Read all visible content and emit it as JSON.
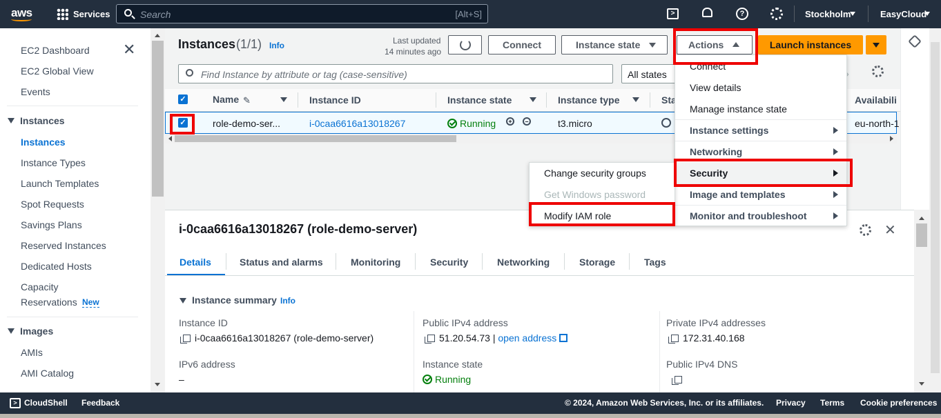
{
  "topnav": {
    "logo": "aws",
    "services": "Services",
    "search_placeholder": "Search",
    "search_shortcut": "[Alt+S]",
    "region": "Stockholm",
    "account": "EasyCloud"
  },
  "sidebar": {
    "items_top": [
      "EC2 Dashboard",
      "EC2 Global View",
      "Events"
    ],
    "instances_header": "Instances",
    "instances_items": [
      "Instances",
      "Instance Types",
      "Launch Templates",
      "Spot Requests",
      "Savings Plans",
      "Reserved Instances",
      "Dedicated Hosts",
      "Capacity",
      "Reservations"
    ],
    "new_badge": "New",
    "images_header": "Images",
    "images_items": [
      "AMIs",
      "AMI Catalog"
    ]
  },
  "main": {
    "title": "Instances",
    "count": "(1/1)",
    "info": "Info",
    "last_updated_label": "Last updated",
    "last_updated_value": "14 minutes ago",
    "connect": "Connect",
    "instance_state": "Instance state",
    "actions": "Actions",
    "launch": "Launch instances",
    "filter_placeholder": "Find Instance by attribute or tag (case-sensitive)",
    "states_filter": "All states",
    "columns": [
      "Name",
      "Instance ID",
      "Instance state",
      "Instance type",
      "Sta",
      "Availabili"
    ],
    "row": {
      "name": "role-demo-ser...",
      "id": "i-0caa6616a13018267",
      "state": "Running",
      "type": "t3.micro",
      "az": "eu-north-1"
    }
  },
  "actions_menu": {
    "items": [
      "Connect",
      "View details",
      "Manage instance state",
      "Instance settings",
      "Networking",
      "Security",
      "Image and templates",
      "Monitor and troubleshoot"
    ]
  },
  "security_submenu": {
    "items": [
      "Change security groups",
      "Get Windows password",
      "Modify IAM role"
    ]
  },
  "details": {
    "title": "i-0caa6616a13018267 (role-demo-server)",
    "tabs": [
      "Details",
      "Status and alarms",
      "Monitoring",
      "Security",
      "Networking",
      "Storage",
      "Tags"
    ],
    "section": "Instance summary",
    "info": "Info",
    "instance_id_label": "Instance ID",
    "instance_id_value": "i-0caa6616a13018267 (role-demo-server)",
    "public_ipv4_label": "Public IPv4 address",
    "public_ipv4_value": "51.20.54.73",
    "open_address": "open address",
    "private_ipv4_label": "Private IPv4 addresses",
    "private_ipv4_value": "172.31.40.168",
    "ipv6_label": "IPv6 address",
    "ipv6_value": "–",
    "state_label": "Instance state",
    "state_value": "Running",
    "public_dns_label": "Public IPv4 DNS"
  },
  "footer": {
    "cloudshell": "CloudShell",
    "feedback": "Feedback",
    "copyright": "© 2024, Amazon Web Services, Inc. or its affiliates.",
    "privacy": "Privacy",
    "terms": "Terms",
    "cookies": "Cookie preferences"
  },
  "colors": {
    "nav": "#232f3e",
    "accent_orange": "#ff9900",
    "link": "#0972d3",
    "success": "#037f0c",
    "highlight_red": "#e00000"
  }
}
